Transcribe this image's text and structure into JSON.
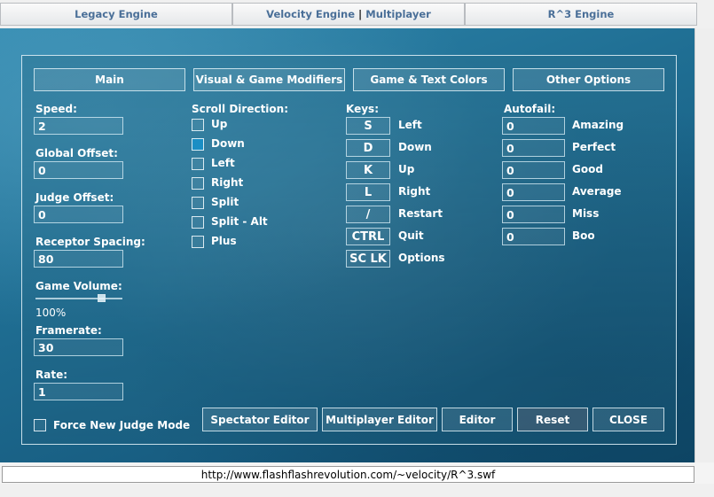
{
  "engine_tabs": {
    "legacy": "Legacy Engine",
    "velocity": "Velocity Engine",
    "separator": "|",
    "multiplayer": "Multiplayer",
    "r3": "R^3 Engine"
  },
  "panel_tabs": [
    "Main",
    "Visual & Game Modifiers",
    "Game & Text Colors",
    "Other Options"
  ],
  "settings": {
    "speed_label": "Speed:",
    "speed_value": "2",
    "global_offset_label": "Global Offset:",
    "global_offset_value": "0",
    "judge_offset_label": "Judge Offset:",
    "judge_offset_value": "0",
    "receptor_spacing_label": "Receptor Spacing:",
    "receptor_spacing_value": "80",
    "game_volume_label": "Game Volume:",
    "game_volume_value": "100%",
    "game_volume_level": 0.75,
    "framerate_label": "Framerate:",
    "framerate_value": "30",
    "rate_label": "Rate:",
    "rate_value": "1",
    "force_judge_label": "Force New Judge Mode"
  },
  "scroll": {
    "label": "Scroll Direction:",
    "options": [
      {
        "label": "Up",
        "checked": false
      },
      {
        "label": "Down",
        "checked": true
      },
      {
        "label": "Left",
        "checked": false
      },
      {
        "label": "Right",
        "checked": false
      },
      {
        "label": "Split",
        "checked": false
      },
      {
        "label": "Split - Alt",
        "checked": false
      },
      {
        "label": "Plus",
        "checked": false
      }
    ]
  },
  "keys": {
    "label": "Keys:",
    "bindings": [
      {
        "key": "S",
        "action": "Left"
      },
      {
        "key": "D",
        "action": "Down"
      },
      {
        "key": "K",
        "action": "Up"
      },
      {
        "key": "L",
        "action": "Right"
      },
      {
        "key": "/",
        "action": "Restart"
      },
      {
        "key": "CTRL",
        "action": "Quit"
      },
      {
        "key": "SC LK",
        "action": "Options"
      }
    ]
  },
  "autofail": {
    "label": "Autofail:",
    "items": [
      {
        "value": "0",
        "label": "Amazing"
      },
      {
        "value": "0",
        "label": "Perfect"
      },
      {
        "value": "0",
        "label": "Good"
      },
      {
        "value": "0",
        "label": "Average"
      },
      {
        "value": "0",
        "label": "Miss"
      },
      {
        "value": "0",
        "label": "Boo"
      }
    ]
  },
  "buttons": {
    "spectator": "Spectator Editor",
    "multiplayer": "Multiplayer Editor",
    "editor": "Editor",
    "reset": "Reset",
    "close": "CLOSE"
  },
  "url": "http://www.flashflashrevolution.com/~velocity/R^3.swf",
  "colors": {
    "accent": "#1a8ec4",
    "link": "#4a6f98",
    "stage": "#1f6e93"
  }
}
